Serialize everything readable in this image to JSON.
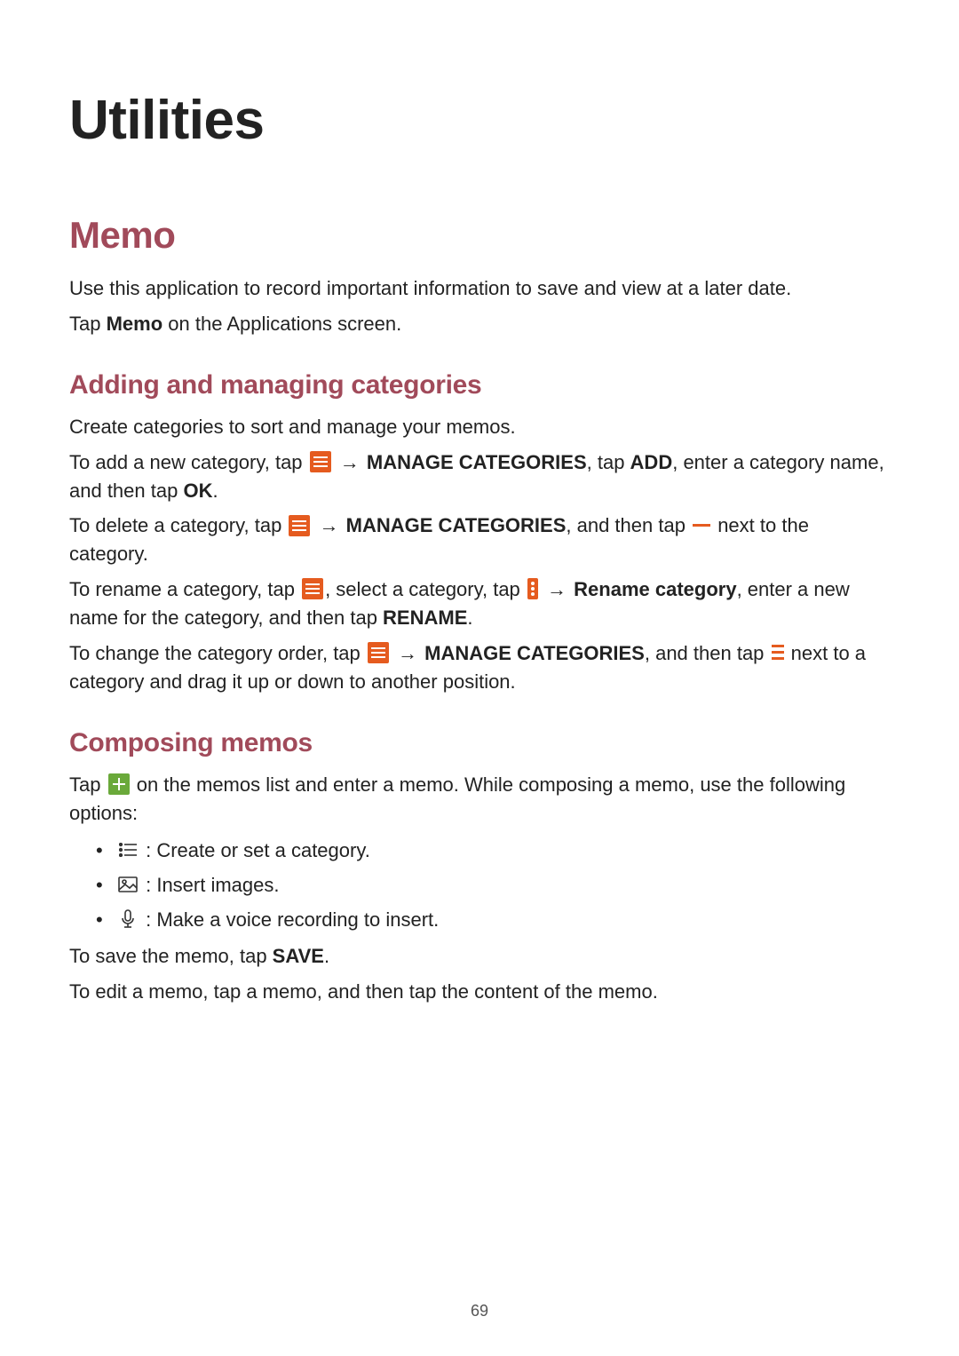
{
  "page_number": "69",
  "title": "Utilities",
  "memo": {
    "heading": "Memo",
    "intro1": "Use this application to record important information to save and view at a later date.",
    "intro2_pre": "Tap ",
    "intro2_bold": "Memo",
    "intro2_post": " on the Applications screen.",
    "sub1": {
      "heading": "Adding and managing categories",
      "p1": "Create categories to sort and manage your memos.",
      "add_pre": "To add a new category, tap ",
      "add_arrow": " → ",
      "add_b1": "MANAGE CATEGORIES",
      "add_mid": ", tap ",
      "add_b2": "ADD",
      "add_post1": ", enter a category name, and then tap ",
      "add_b3": "OK",
      "add_end": ".",
      "del_pre": "To delete a category, tap ",
      "del_arrow": " → ",
      "del_b1": "MANAGE CATEGORIES",
      "del_mid": ", and then tap ",
      "del_post": " next to the category.",
      "ren_pre": "To rename a category, tap ",
      "ren_mid1": ", select a category, tap ",
      "ren_arrow": " → ",
      "ren_b1": "Rename category",
      "ren_mid2": ", enter a new name for the category, and then tap ",
      "ren_b2": "RENAME",
      "ren_end": ".",
      "ord_pre": "To change the category order, tap ",
      "ord_arrow": " → ",
      "ord_b1": "MANAGE CATEGORIES",
      "ord_mid": ", and then tap ",
      "ord_post": " next to a category and drag it up or down to another position."
    },
    "sub2": {
      "heading": "Composing memos",
      "p1_pre": "Tap ",
      "p1_post": " on the memos list and enter a memo. While composing a memo, use the following options:",
      "li1": " : Create or set a category.",
      "li2": " : Insert images.",
      "li3": " : Make a voice recording to insert.",
      "save_pre": "To save the memo, tap ",
      "save_b": "SAVE",
      "save_end": ".",
      "edit": "To edit a memo, tap a memo, and then tap the content of the memo."
    }
  }
}
